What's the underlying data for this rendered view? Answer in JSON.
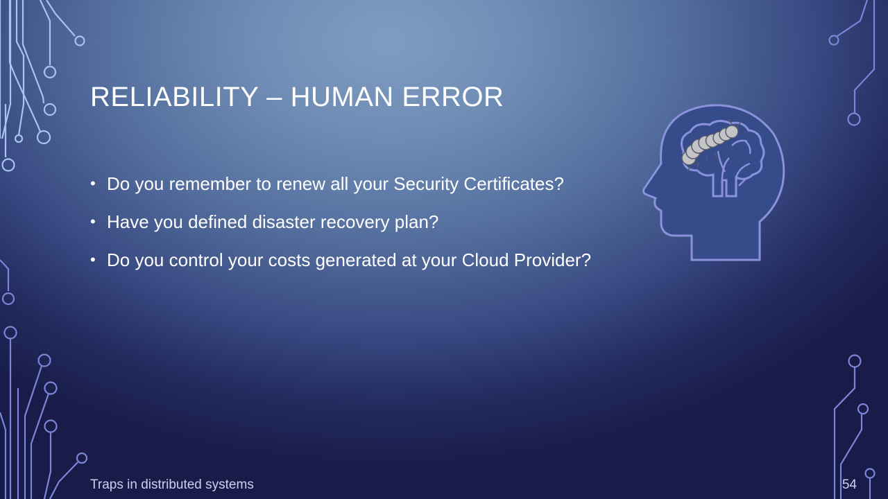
{
  "slide": {
    "title": "RELIABILITY – HUMAN ERROR",
    "bullets": [
      "Do you remember to renew all your Security Certificates?",
      "Have you defined disaster recovery plan?",
      "Do you control your costs generated at your Cloud Provider?"
    ],
    "bullet_glyph": "•",
    "footer": "Traps in distributed systems",
    "page_number": "54"
  },
  "icons": {
    "decorations": [
      "circuit-trace-icon"
    ],
    "illustration": "head-brain-bug-icon"
  },
  "colors": {
    "circuit_light": "#a9c4ef",
    "circuit_dark": "#7b86d8",
    "head_fill": "#364b8a",
    "head_outline": "#8b92dc",
    "bug_fill": "#c4c4c4"
  }
}
